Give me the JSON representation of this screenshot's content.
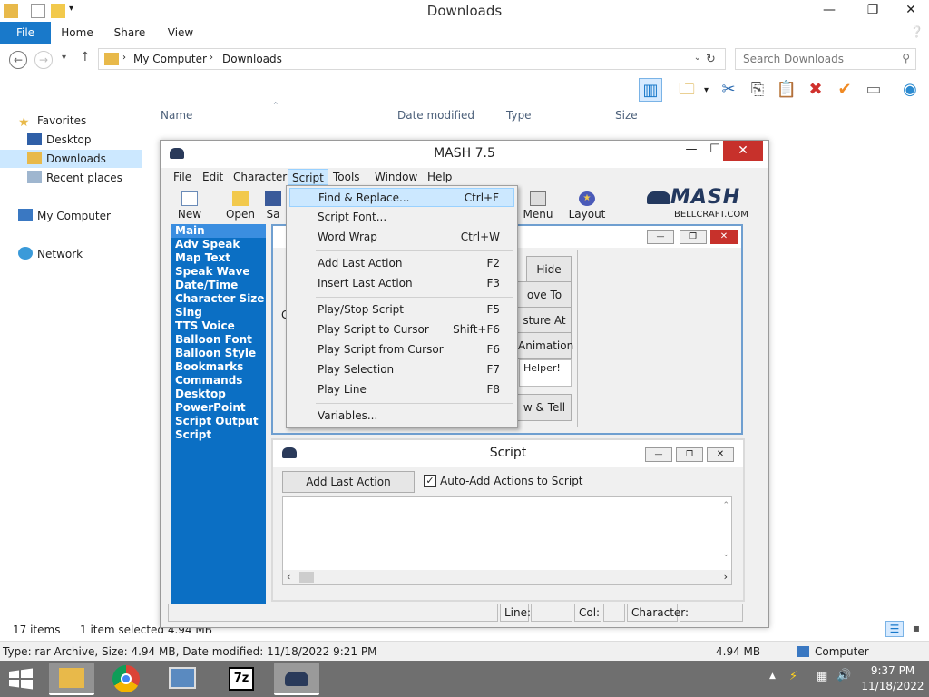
{
  "explorer": {
    "title": "Downloads",
    "tabs": {
      "file": "File",
      "home": "Home",
      "share": "Share",
      "view": "View"
    },
    "breadcrumb": [
      "My Computer",
      "Downloads"
    ],
    "search_placeholder": "Search Downloads",
    "nav": {
      "favorites": "Favorites",
      "desktop": "Desktop",
      "downloads": "Downloads",
      "recent": "Recent places",
      "computer": "My Computer",
      "network": "Network"
    },
    "columns": {
      "name": "Name",
      "date": "Date modified",
      "type": "Type",
      "size": "Size"
    },
    "status": {
      "items": "17 items",
      "selected": "1 item selected  4.94 MB"
    },
    "details": {
      "text": "Type: rar Archive, Size: 4.94 MB, Date modified: 11/18/2022 9:21 PM",
      "size": "4.94 MB",
      "location": "Computer"
    }
  },
  "mash": {
    "title": "MASH 7.5",
    "menu": [
      "File",
      "Edit",
      "Character",
      "Script",
      "Tools",
      "Window",
      "Help"
    ],
    "tools": {
      "new": "New",
      "open": "Open",
      "save": "Sa",
      "menu": "Menu",
      "layout": "Layout"
    },
    "logo": {
      "word": "MASH",
      "site": "BELLCRAFT.COM"
    },
    "side_list": [
      "Main",
      "Adv Speak",
      "Map Text",
      "Speak Wave",
      "Date/Time",
      "Character Size",
      "Sing",
      "TTS Voice",
      "Balloon Font",
      "Balloon Style",
      "Bookmarks",
      "Commands",
      "Desktop",
      "PowerPoint",
      "Script Output",
      "Script"
    ],
    "child1": {
      "buttons": {
        "hide": "Hide",
        "move": "ove To",
        "gesture": "sture At",
        "animation": "Animation",
        "tell": "w & Tell"
      },
      "helper_text": "Helper!",
      "edge_char": "G"
    },
    "script_window": {
      "title": "Script",
      "add_last": "Add Last Action",
      "auto_add": "Auto-Add Actions to Script"
    },
    "status": {
      "line": "Line:",
      "col": "Col:",
      "character": "Character:"
    }
  },
  "dropdown": {
    "items": [
      {
        "label": "Find & Replace...",
        "shortcut": "Ctrl+F"
      },
      {
        "label": "Script Font...",
        "shortcut": ""
      },
      {
        "label": "Word Wrap",
        "shortcut": "Ctrl+W"
      },
      {
        "label": "Add Last Action",
        "shortcut": "F2"
      },
      {
        "label": "Insert Last Action",
        "shortcut": "F3"
      },
      {
        "label": "Play/Stop Script",
        "shortcut": "F5"
      },
      {
        "label": "Play Script to Cursor",
        "shortcut": "Shift+F6"
      },
      {
        "label": "Play Script from Cursor",
        "shortcut": "F6"
      },
      {
        "label": "Play Selection",
        "shortcut": "F7"
      },
      {
        "label": "Play Line",
        "shortcut": "F8"
      },
      {
        "label": "Variables...",
        "shortcut": ""
      }
    ]
  },
  "taskbar": {
    "time": "9:37 PM",
    "date": "11/18/2022",
    "sevenzip": "7z"
  },
  "colors": {
    "accent": "#1979ca",
    "list_bg": "#0b6fc4",
    "close_red": "#c7312b"
  }
}
